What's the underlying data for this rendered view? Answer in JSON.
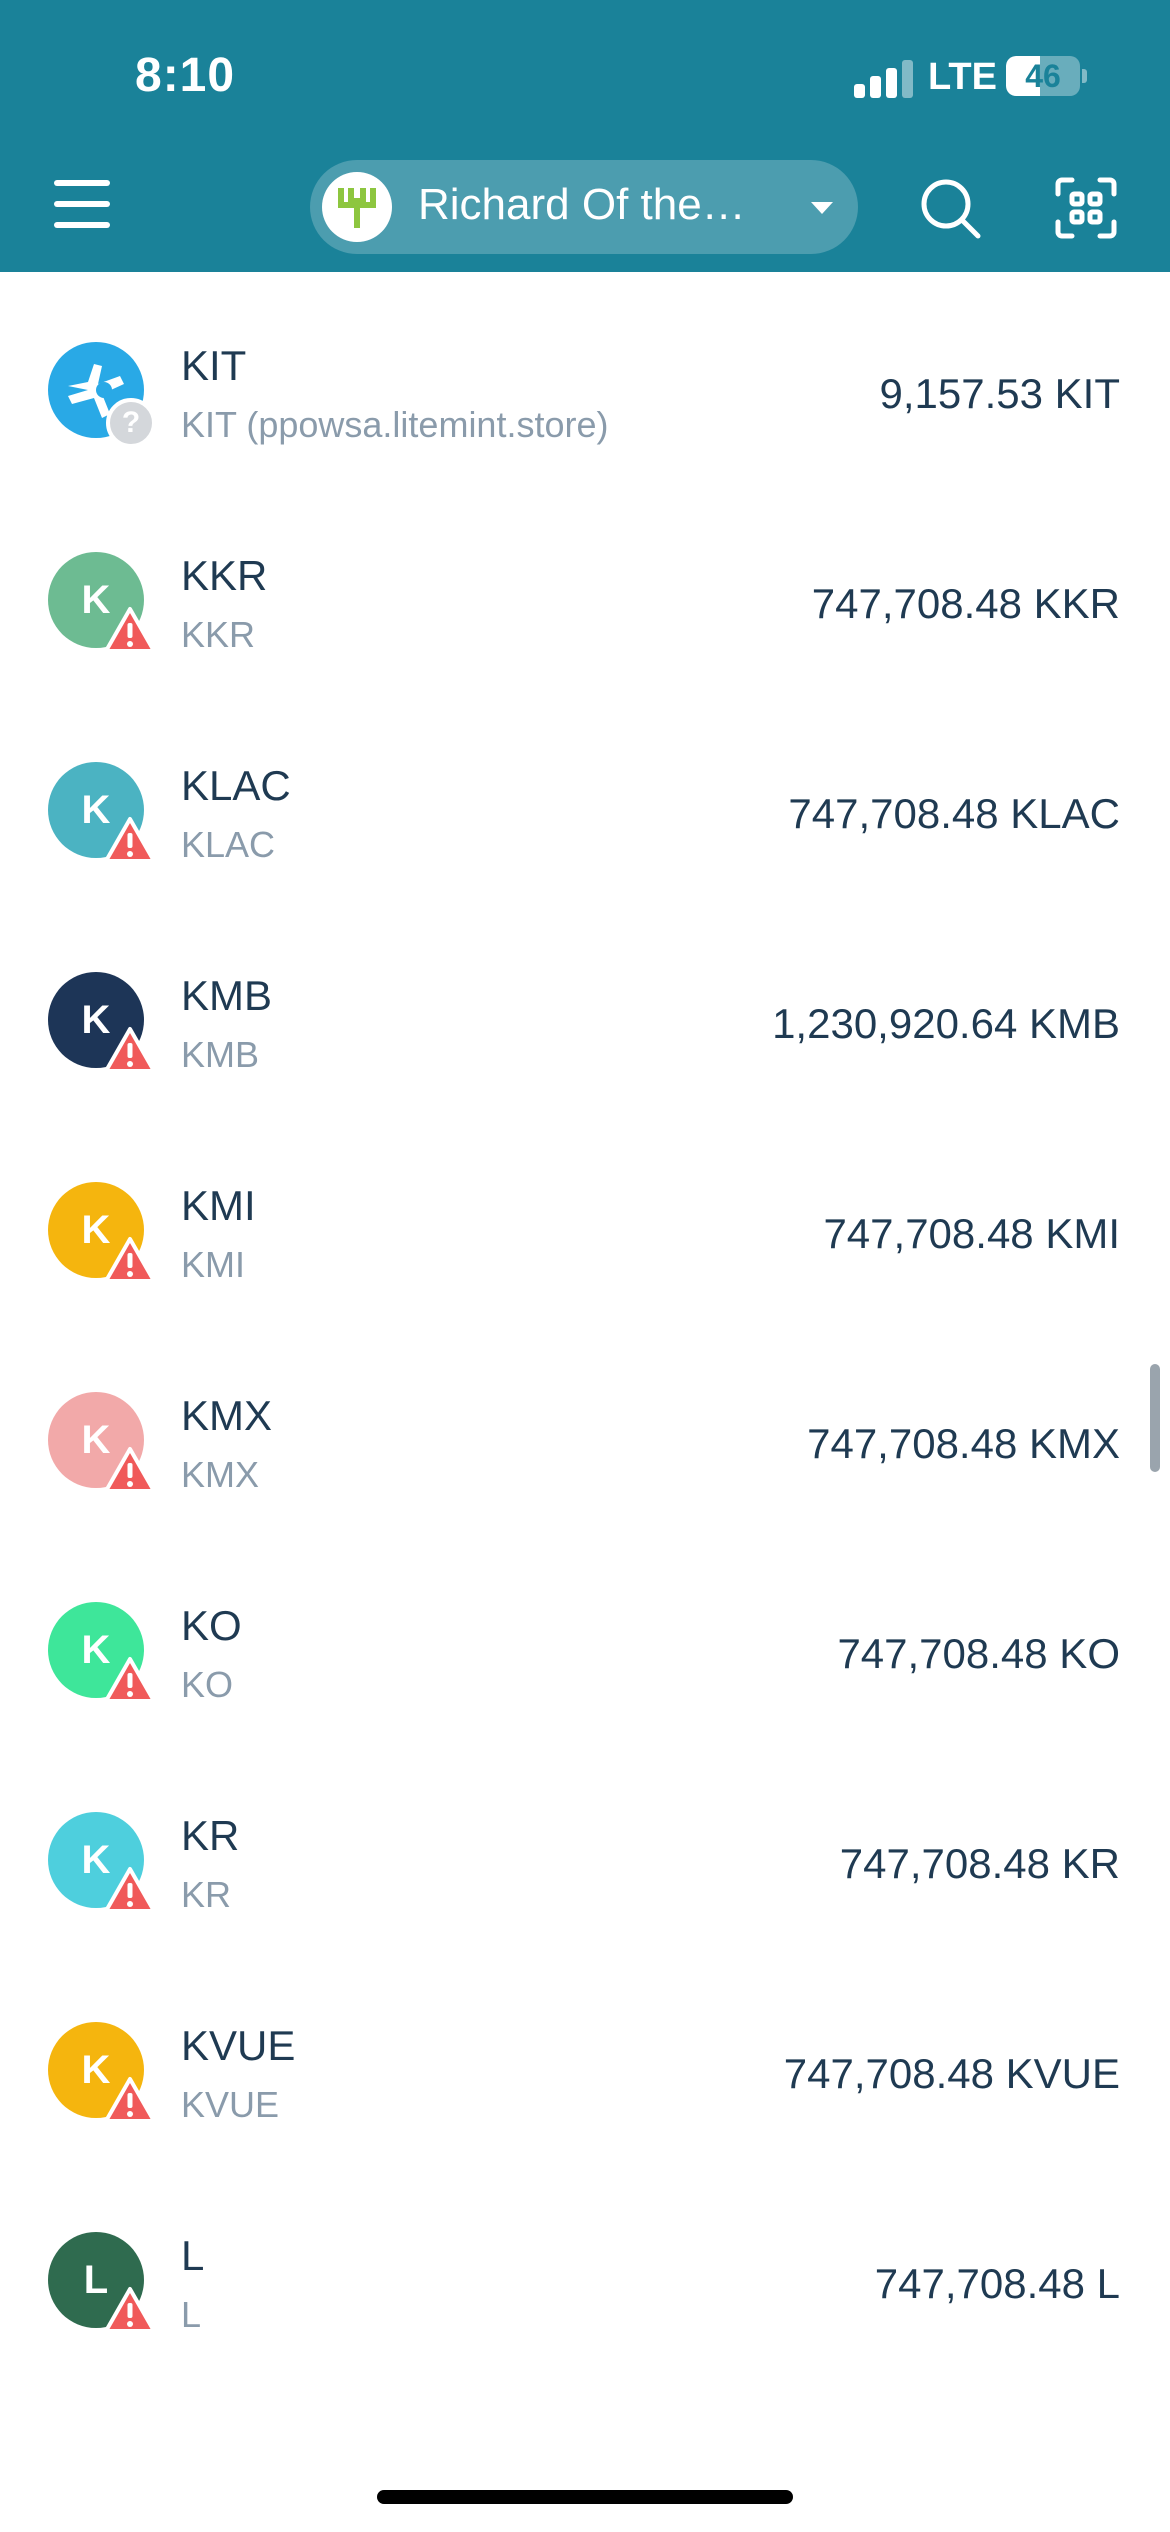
{
  "status_bar": {
    "time": "8:10",
    "network": "LTE",
    "battery": "46",
    "battery_level": 0.46
  },
  "header": {
    "account_name": "Richard Of the…",
    "icons": {
      "menu": "hamburger-menu-icon",
      "search": "search-icon",
      "scan": "qr-scan-icon",
      "caret": "chevron-down-icon"
    },
    "colors": {
      "header_bg": "#1a8299"
    }
  },
  "assets": [
    {
      "name": "KIT",
      "sub": "KIT (ppowsa.litemint.store)",
      "amount": "9,157.53 KIT",
      "letter": "",
      "color": "#29a9e6",
      "badge": "unknown"
    },
    {
      "name": "KKR",
      "sub": "KKR",
      "amount": "747,708.48 KKR",
      "letter": "K",
      "color": "#6dbb92",
      "badge": "warning"
    },
    {
      "name": "KLAC",
      "sub": "KLAC",
      "amount": "747,708.48 KLAC",
      "letter": "K",
      "color": "#4bb3c2",
      "badge": "warning"
    },
    {
      "name": "KMB",
      "sub": "KMB",
      "amount": "1,230,920.64 KMB",
      "letter": "K",
      "color": "#1d3557",
      "badge": "warning"
    },
    {
      "name": "KMI",
      "sub": "KMI",
      "amount": "747,708.48 KMI",
      "letter": "K",
      "color": "#f5b50e",
      "badge": "warning"
    },
    {
      "name": "KMX",
      "sub": "KMX",
      "amount": "747,708.48 KMX",
      "letter": "K",
      "color": "#f2a9a9",
      "badge": "warning"
    },
    {
      "name": "KO",
      "sub": "KO",
      "amount": "747,708.48 KO",
      "letter": "K",
      "color": "#3ee69a",
      "badge": "warning"
    },
    {
      "name": "KR",
      "sub": "KR",
      "amount": "747,708.48 KR",
      "letter": "K",
      "color": "#4ecfdd",
      "badge": "warning"
    },
    {
      "name": "KVUE",
      "sub": "KVUE",
      "amount": "747,708.48 KVUE",
      "letter": "K",
      "color": "#f5b50e",
      "badge": "warning"
    },
    {
      "name": "L",
      "sub": "L",
      "amount": "747,708.48 L",
      "letter": "L",
      "color": "#2f6b4f",
      "badge": "warning"
    }
  ],
  "colors": {
    "warning": "#f05a5a",
    "text_primary": "#1f3a52",
    "text_secondary": "#8a9bab"
  }
}
